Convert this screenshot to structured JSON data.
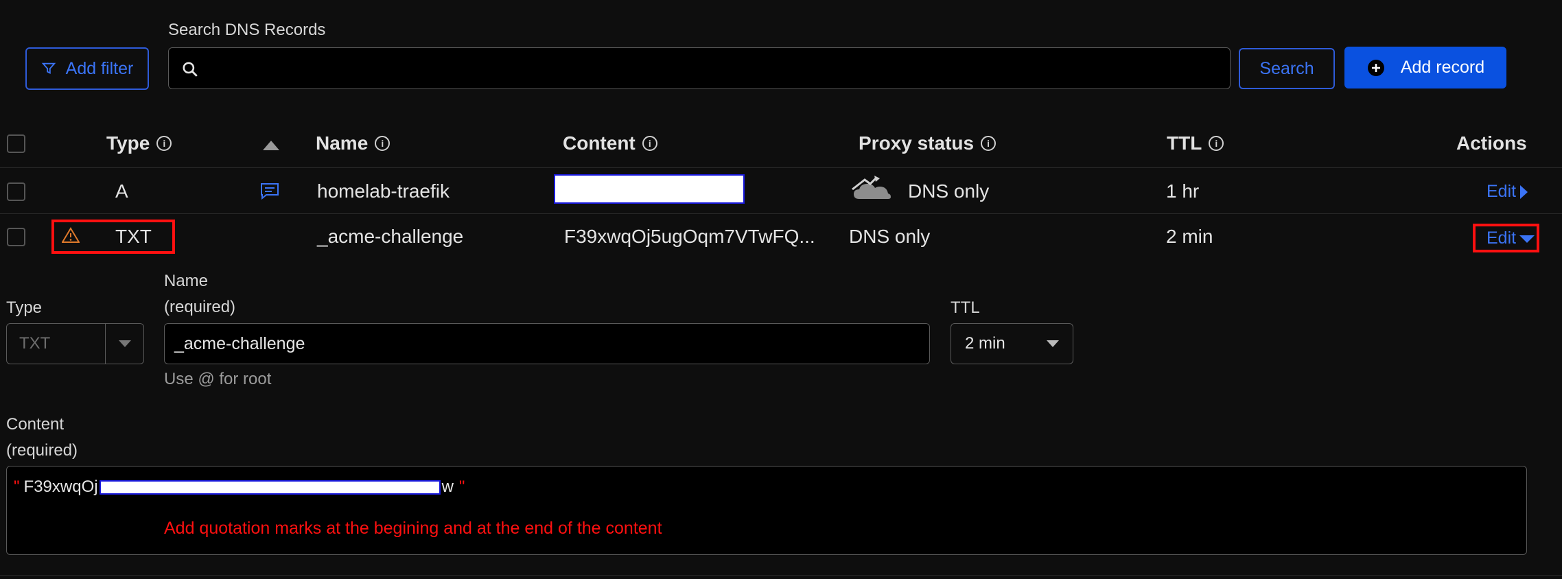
{
  "toolbar": {
    "add_filter_label": "Add filter",
    "search_label": "Search DNS Records",
    "search_placeholder": "",
    "search_button_label": "Search",
    "add_record_label": "Add record"
  },
  "table": {
    "headers": {
      "type": "Type",
      "name": "Name",
      "content": "Content",
      "proxy_status": "Proxy status",
      "ttl": "TTL",
      "actions": "Actions"
    },
    "rows": [
      {
        "type": "A",
        "name": "homelab-traefik",
        "content": "",
        "proxy_status": "DNS only",
        "ttl": "1 hr",
        "action": "Edit"
      },
      {
        "type": "TXT",
        "name": "_acme-challenge",
        "content": "F39xwqOj5ugOqm7VTwFQ...",
        "proxy_status": "DNS only",
        "ttl": "2 min",
        "action": "Edit"
      }
    ]
  },
  "edit_form": {
    "type_label": "Type",
    "type_value": "TXT",
    "name_label": "Name",
    "name_required": "(required)",
    "name_value": "_acme-challenge",
    "name_hint": "Use @ for root",
    "ttl_label": "TTL",
    "ttl_value": "2 min",
    "content_label": "Content",
    "content_required": "(required)",
    "content_open_quote": "\"",
    "content_value_start": "F39xwqOj",
    "content_value_end": "w",
    "content_close_quote": "\"",
    "annotation": "Add quotation marks at the begining and at the end of the content"
  },
  "colors": {
    "accent": "#0a51e0",
    "link": "#3b74f6",
    "annotation_red": "#ff1010",
    "warning": "#e07a2b"
  }
}
